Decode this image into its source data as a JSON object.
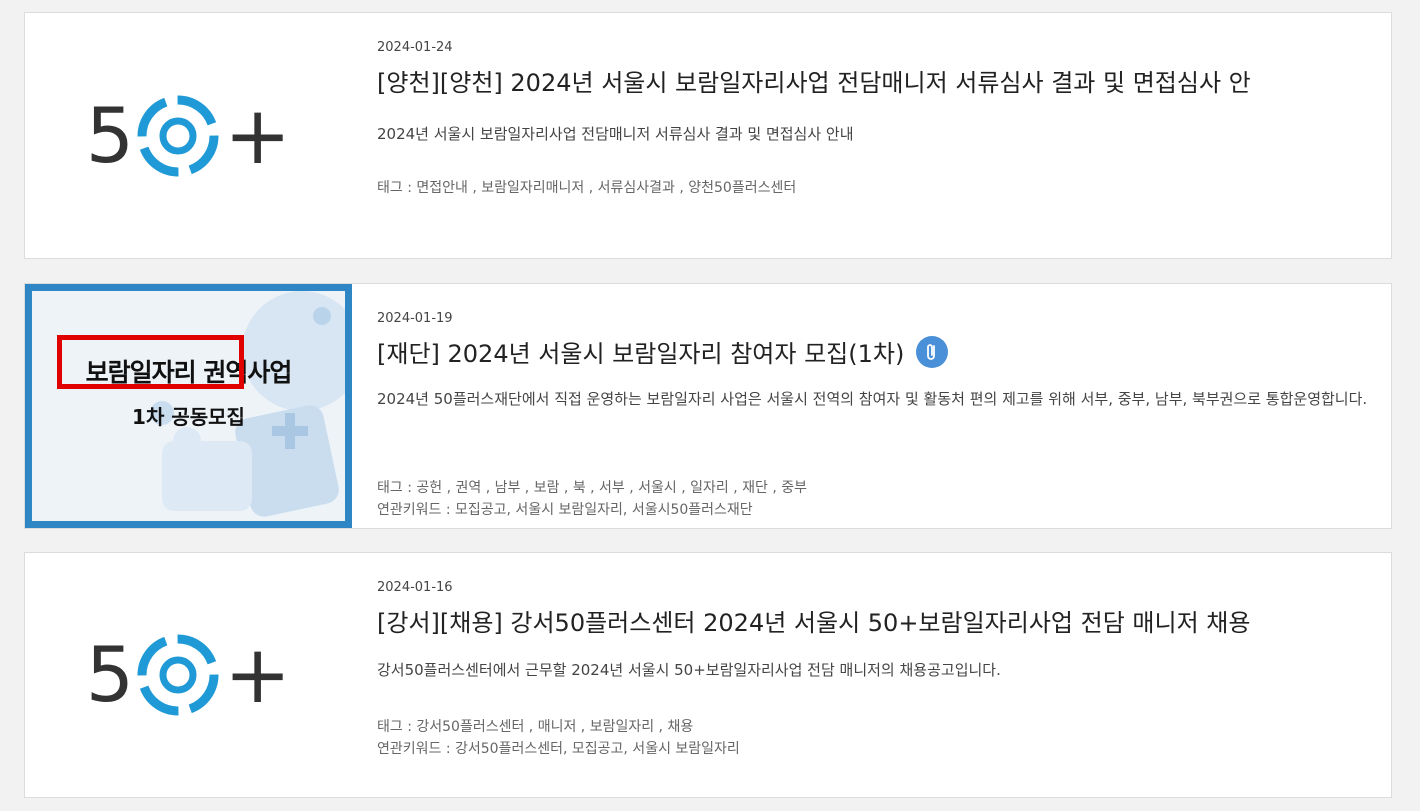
{
  "logo": {
    "five": "5",
    "plus": "+"
  },
  "colors": {
    "logo_blue": "#1f9ad6",
    "logo_dark": "#333333",
    "promo_border": "#2f86c4",
    "highlight_red": "#e00000",
    "clip_blue": "#4a90d9"
  },
  "posts": [
    {
      "date": "2024-01-24",
      "title": "[양천][양천] 2024년 서울시 보람일자리사업 전담매니저 서류심사 결과 및 면접심사 안",
      "description": "2024년 서울시 보람일자리사업 전담매니저 서류심사 결과 및 면접심사 안내",
      "tags": "태그 : 면접안내 , 보람일자리매니저 , 서류심사결과 , 양천50플러스센터"
    },
    {
      "date": "2024-01-19",
      "title": "[재단] 2024년 서울시 보람일자리 참여자 모집(1차)",
      "attachment_icon": "paperclip-icon",
      "description": "2024년 50플러스재단에서 직접 운영하는 보람일자리 사업은 서울시 전역의 참여자 및 활동처 편의 제고를 위해 서부, 중부, 남부, 북부권으로 통합운영합니다.",
      "tags": "태그 : 공헌 , 권역 , 남부 , 보람 , 북 , 서부 , 서울시 , 일자리 , 재단 , 중부",
      "keywords": "연관키워드 : 모집공고, 서울시 보람일자리, 서울시50플러스재단",
      "thumb_title": "보람일자리 권역사업",
      "thumb_subtitle": "1차 공동모집"
    },
    {
      "date": "2024-01-16",
      "title": "[강서][채용] 강서50플러스센터 2024년 서울시 50+보람일자리사업 전담 매니저 채용",
      "description": "강서50플러스센터에서 근무할 2024년 서울시 50+보람일자리사업 전담 매니저의 채용공고입니다.",
      "tags": "태그 : 강서50플러스센터 , 매니저 , 보람일자리 , 채용",
      "keywords": "연관키워드 : 강서50플러스센터, 모집공고, 서울시 보람일자리"
    }
  ]
}
